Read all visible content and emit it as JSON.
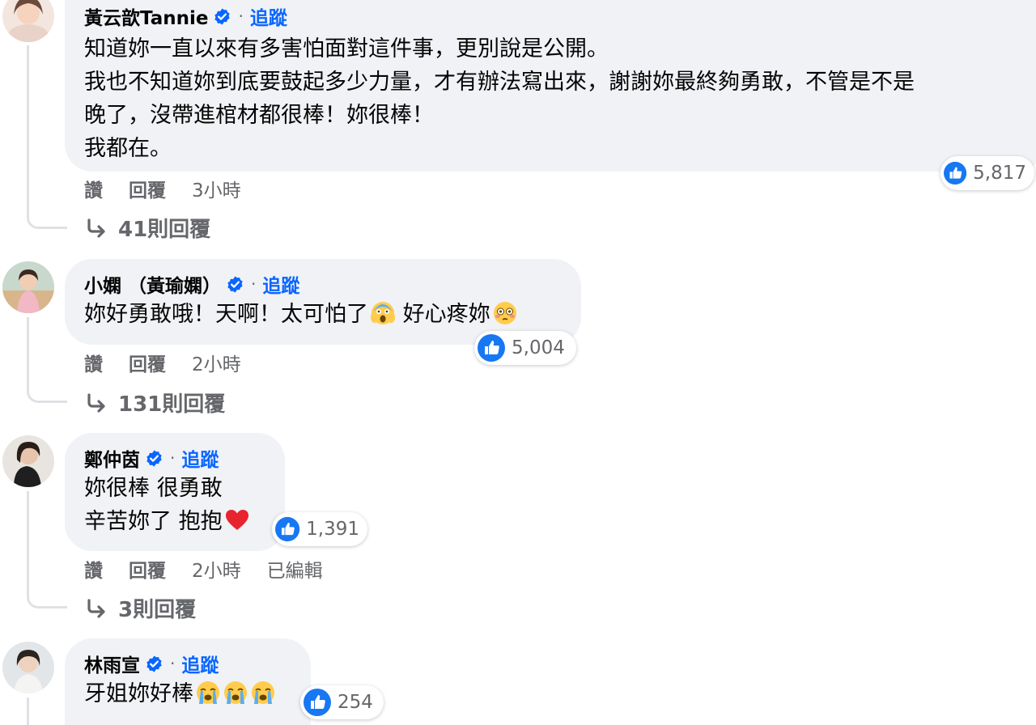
{
  "comments": [
    {
      "author": "黃云歆Tannie",
      "follow": "追蹤",
      "dot": "·",
      "lines": [
        "知道妳一直以來有多害怕面對這件事，更別說是公開。",
        "我也不知道妳到底要鼓起多少力量，才有辦法寫出來，謝謝妳最終夠勇敢，不管是不是",
        "晚了，沒帶進棺材都很棒！妳很棒！",
        "我都在。"
      ],
      "reactions": "5,817",
      "like": "讚",
      "reply": "回覆",
      "time": "3小時",
      "replies": "41則回覆"
    },
    {
      "author": "小嫻 （黃瑜嫻）",
      "follow": "追蹤",
      "dot": "·",
      "line1_a": "妳好勇敢哦！天啊！太可怕了",
      "line1_b": " 好心疼妳",
      "emoji": [
        "screaming-face-emoji",
        "flushed-face-emoji"
      ],
      "reactions": "5,004",
      "like": "讚",
      "reply": "回覆",
      "time": "2小時",
      "replies": "131則回覆"
    },
    {
      "author": "鄭仲茵",
      "follow": "追蹤",
      "dot": "·",
      "line1": "妳很棒 很勇敢",
      "line2": "辛苦妳了 抱抱",
      "emoji": [
        "red-heart-emoji"
      ],
      "reactions": "1,391",
      "like": "讚",
      "reply": "回覆",
      "time": "2小時",
      "edited": "已編輯",
      "replies": "3則回覆"
    },
    {
      "author": "林雨宣",
      "follow": "追蹤",
      "dot": "·",
      "line1": "牙姐妳好棒",
      "emoji": [
        "loudly-crying-face-emoji",
        "loudly-crying-face-emoji",
        "loudly-crying-face-emoji"
      ],
      "reactions": "254"
    }
  ],
  "colors": {
    "bubble": "#f0f2f5",
    "follow": "#0866ff",
    "like_badge": "#1877f2",
    "muted": "#65676b"
  },
  "icons": [
    "verified-badge-icon",
    "like-reaction-icon",
    "reply-arrow-icon"
  ]
}
